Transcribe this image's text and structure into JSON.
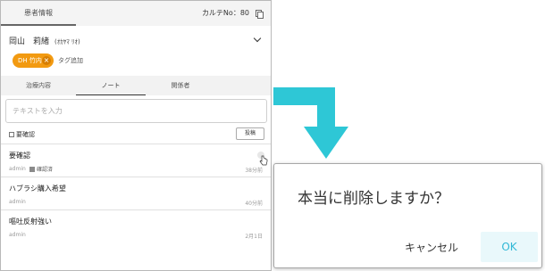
{
  "panel": {
    "tab_label": "患者情報",
    "chart_number": "カルテNo：80",
    "patient": {
      "name": "岡山　莉緒",
      "kana": "(ｵｶﾔﾏ ﾘｵ)"
    },
    "tag": {
      "label": "DH 竹内",
      "remove": "×"
    },
    "add_tag": "タグ追加",
    "subtabs": [
      "治療内容",
      "ノート",
      "関係者"
    ],
    "input_placeholder": "テキストを入力",
    "confirm_label": "要確認",
    "post_label": "投稿",
    "notes": [
      {
        "title": "要確認",
        "author": "admin",
        "status": "確認済",
        "time": "38分前"
      },
      {
        "title": "ハブラシ購入希望",
        "author": "admin",
        "time": "40分前"
      },
      {
        "title": "嘔吐反射強い",
        "author": "admin",
        "time": "2月1日"
      }
    ]
  },
  "dialog": {
    "message": "本当に削除しますか？",
    "cancel": "キャンセル",
    "ok": "OK"
  },
  "colors": {
    "accent": "#2ec7d6",
    "tag": "#f29a11",
    "ok_bg": "#e9f8fb",
    "ok_text": "#31b8d6"
  }
}
